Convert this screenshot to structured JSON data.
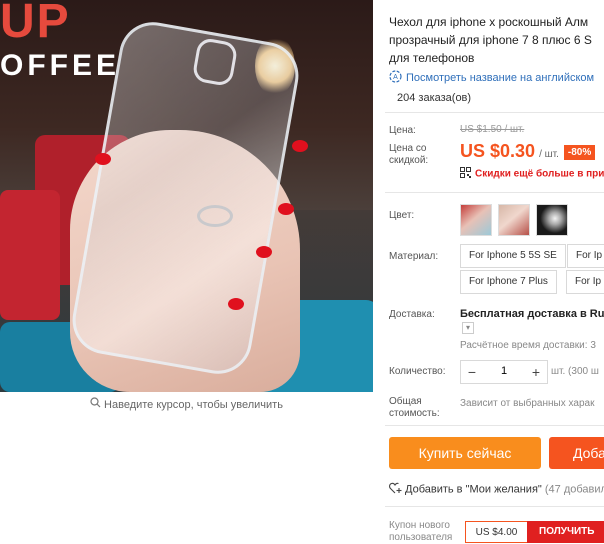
{
  "gallery": {
    "zoom_hint": "Наведите курсор, чтобы увеличить",
    "sign_line1": "UP",
    "sign_line2": "OFFEE"
  },
  "product": {
    "title_lines": [
      "Чехол для iphone x роскошный Алм",
      "прозрачный для iphone 7 8 плюс 6 S",
      "для телефонов"
    ],
    "translate_link": "Посмотреть название на английском",
    "orders": "204 заказа(ов)"
  },
  "pricing": {
    "price_label": "Цена:",
    "old_price": "US $1.50 / шт.",
    "discount_price_label_1": "Цена со",
    "discount_price_label_2": "скидкой:",
    "price": "US $0.30",
    "unit": "/ шт.",
    "discount_badge": "-80%",
    "bulk_discount": "Скидки ещё больше в при"
  },
  "options": {
    "color_label": "Цвет:",
    "material_label": "Материал:",
    "material_options": [
      "For Iphone 5 5S SE",
      "For Ip",
      "For Iphone 7 Plus",
      "For Ip"
    ]
  },
  "shipping": {
    "label": "Доставка:",
    "title": "Бесплатная доставка в Russ",
    "time": "Расчётное время доставки: 3"
  },
  "quantity": {
    "label": "Количество:",
    "minus": "−",
    "value": "1",
    "plus": "+",
    "stock": "шт. (300 ш"
  },
  "total": {
    "label_1": "Общая",
    "label_2": "стоимость:",
    "value": "Зависит от выбранных харак"
  },
  "actions": {
    "buy_now": "Купить сейчас",
    "add_to_cart": "Доба",
    "wishlist": "Добавить в \"Мои желания\"",
    "wishlist_count": "(47 добавили"
  },
  "coupon": {
    "label_1": "Купон нового",
    "label_2": "пользователя",
    "value": "US $4.00",
    "button": "ПОЛУЧИТЬ"
  },
  "colors": {
    "price_accent": "#f5541f",
    "buy_button": "#f98d1d",
    "link": "#2f6fba",
    "alert": "#e02020"
  }
}
